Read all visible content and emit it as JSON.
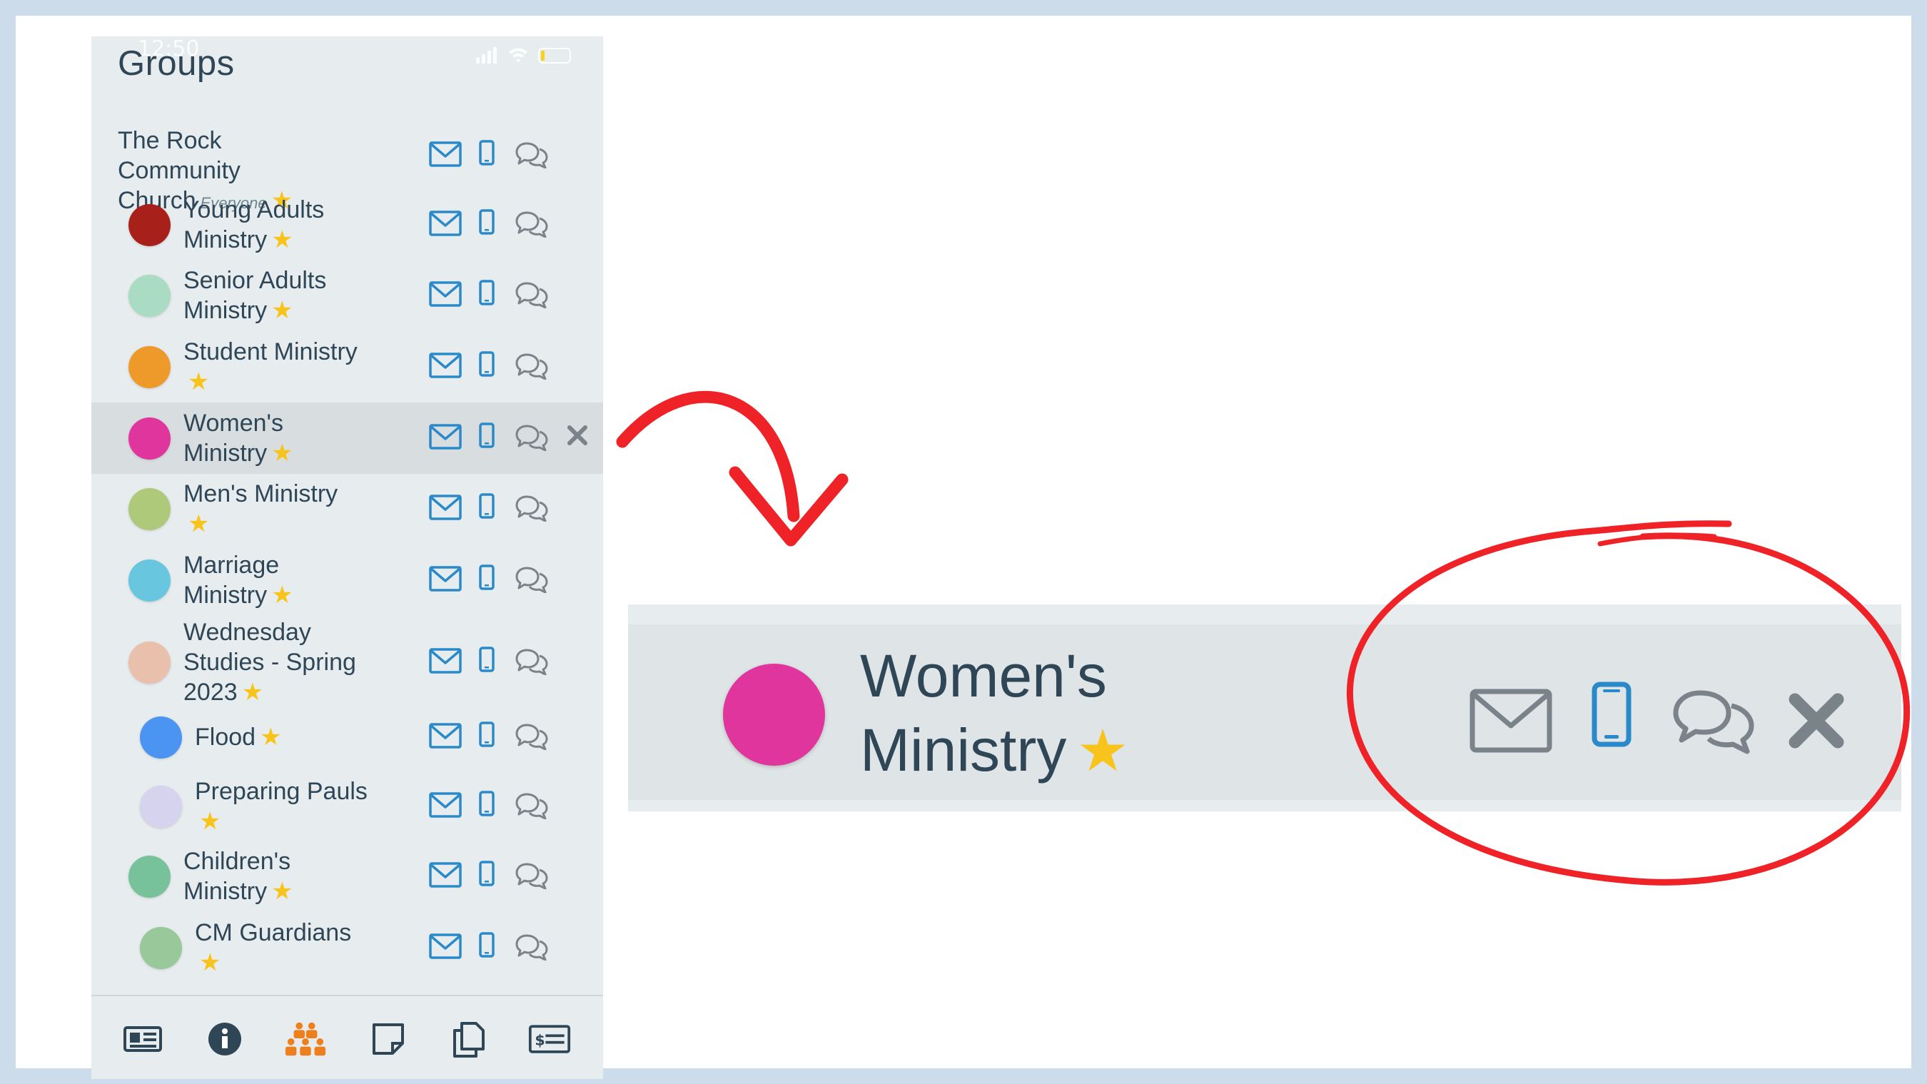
{
  "status": {
    "time": "12:50"
  },
  "page": {
    "title": "Groups"
  },
  "groups": [
    {
      "name_line1": "The Rock Community",
      "name_line2": "Church",
      "tag": "Everyone",
      "color": null,
      "starred": true
    },
    {
      "name_line1": "Young Adults",
      "name_line2": "Ministry",
      "color": "#a8201a",
      "starred": true
    },
    {
      "name_line1": "Senior Adults",
      "name_line2": "Ministry",
      "color": "#a9dcc3",
      "starred": true
    },
    {
      "name_line1": "Student Ministry",
      "name_line2": "",
      "color": "#ee9a2b",
      "starred": true
    },
    {
      "name_line1": "Women's",
      "name_line2": "Ministry",
      "color": "#e0359c",
      "starred": true,
      "selected": true
    },
    {
      "name_line1": "Men's Ministry",
      "name_line2": "",
      "color": "#afc97a",
      "starred": true
    },
    {
      "name_line1": "Marriage",
      "name_line2": "Ministry",
      "color": "#68c6df",
      "starred": true
    },
    {
      "name_line1": "Wednesday",
      "name_line2": "Studies - Spring",
      "name_line3": "2023",
      "color": "#e8c0ab",
      "starred": true
    },
    {
      "name_line1": "Flood",
      "name_line2": "",
      "color": "#4b94f2",
      "starred": true
    },
    {
      "name_line1": "Preparing Pauls",
      "name_line2": "",
      "color": "#d5d3ee",
      "starred": true
    },
    {
      "name_line1": "Children's",
      "name_line2": "Ministry",
      "color": "#78c29b",
      "starred": true
    },
    {
      "name_line1": "CM Guardians",
      "name_line2": "",
      "color": "#99c89a",
      "starred": true
    }
  ],
  "row_actions": {
    "mail": "mail-icon",
    "text": "phone-icon",
    "chat": "chat-icon",
    "remove": "close-icon"
  },
  "tabbar": [
    "news-icon",
    "info-icon",
    "groups-icon",
    "notes-icon",
    "pages-icon",
    "giving-icon"
  ],
  "active_tab": "groups-icon",
  "zoom": {
    "name_line1": "Women's",
    "name_line2": "Ministry",
    "color": "#e0359c"
  },
  "colors": {
    "accent_blue": "#2a8ac9",
    "icon_gray": "#7a8389",
    "tab_active": "#ee7f1d",
    "annotation_red": "#ee2227",
    "star": "#f8c31b"
  }
}
